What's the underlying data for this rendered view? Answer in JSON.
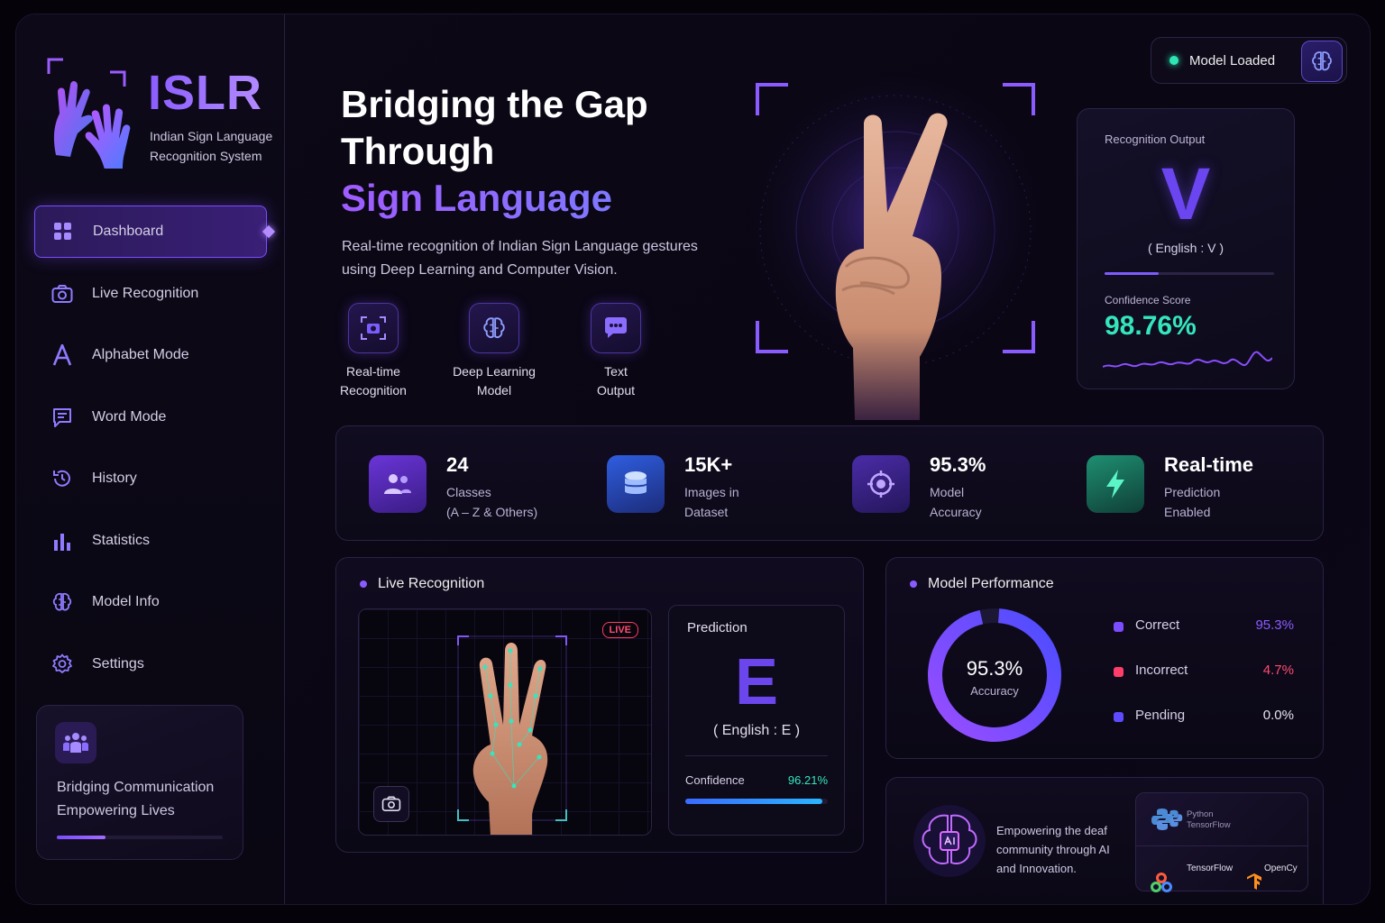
{
  "brand": {
    "title": "ISLR",
    "subtitle": "Indian Sign Language Recognition System"
  },
  "sidebar": {
    "items": [
      {
        "label": "Dashboard",
        "icon": "grid-icon",
        "active": true
      },
      {
        "label": "Live Recognition",
        "icon": "camera-icon"
      },
      {
        "label": "Alphabet Mode",
        "icon": "letter-a-icon"
      },
      {
        "label": "Word Mode",
        "icon": "chat-icon"
      },
      {
        "label": "History",
        "icon": "history-icon"
      },
      {
        "label": "Statistics",
        "icon": "bar-chart-icon"
      },
      {
        "label": "Model Info",
        "icon": "brain-icon"
      },
      {
        "label": "Settings",
        "icon": "gear-icon"
      }
    ],
    "card": {
      "line1": "Bridging Communication",
      "line2": "Empowering Lives",
      "progress": 0.29
    }
  },
  "hero": {
    "title_line1": "Bridging the Gap",
    "title_line2": "Through",
    "title_accent": "Sign Language",
    "description": "Real-time recognition of Indian Sign Language gestures using Deep Learning and Computer Vision.",
    "features": [
      {
        "line1": "Real-time",
        "line2": "Recognition",
        "icon": "camera-icon"
      },
      {
        "line1": "Deep Learning",
        "line2": "Model",
        "icon": "brain-icon"
      },
      {
        "line1": "Text",
        "line2": "Output",
        "icon": "chat-icon"
      }
    ]
  },
  "status": {
    "label": "Model Loaded",
    "color": "#2ee6b4"
  },
  "recognition_output": {
    "label": "Recognition Output",
    "letter": "V",
    "english": "( English : V )",
    "confidence_label": "Confidence Score",
    "confidence": "98.76%"
  },
  "stats": [
    {
      "value": "24",
      "line1": "Classes",
      "line2": "(A – Z & Others)",
      "icon": "users-icon"
    },
    {
      "value": "15K+",
      "line1": "Images in",
      "line2": "Dataset",
      "icon": "database-icon"
    },
    {
      "value": "95.3%",
      "line1": "Model",
      "line2": "Accuracy",
      "icon": "target-icon"
    },
    {
      "value": "Real-time",
      "line1": "Prediction",
      "line2": "Enabled",
      "icon": "lightning-icon"
    }
  ],
  "live": {
    "title": "Live Recognition",
    "badge": "LIVE",
    "prediction_label": "Prediction",
    "prediction": "E",
    "english": "( English : E )",
    "confidence_label": "Confidence",
    "confidence": "96.21%"
  },
  "performance": {
    "title": "Model Performance",
    "center_value": "95.3%",
    "center_label": "Accuracy",
    "legend": [
      {
        "label": "Correct",
        "value": "95.3%",
        "color": "#7b4dff",
        "value_color": "#8a5cff"
      },
      {
        "label": "Incorrect",
        "value": "4.7%",
        "color": "#ff3d6b",
        "value_color": "#ff4b70"
      },
      {
        "label": "Pending",
        "value": "0.0%",
        "color": "#5d4cff",
        "value_color": "#e6e2f2"
      }
    ]
  },
  "about": {
    "text": "Empowering the deaf community through AI and Innovation.",
    "tech": {
      "python": "Python",
      "python_sub": "TensorFlow",
      "tensorflow": "TensorFlow",
      "opencv": "OpenCy"
    }
  }
}
